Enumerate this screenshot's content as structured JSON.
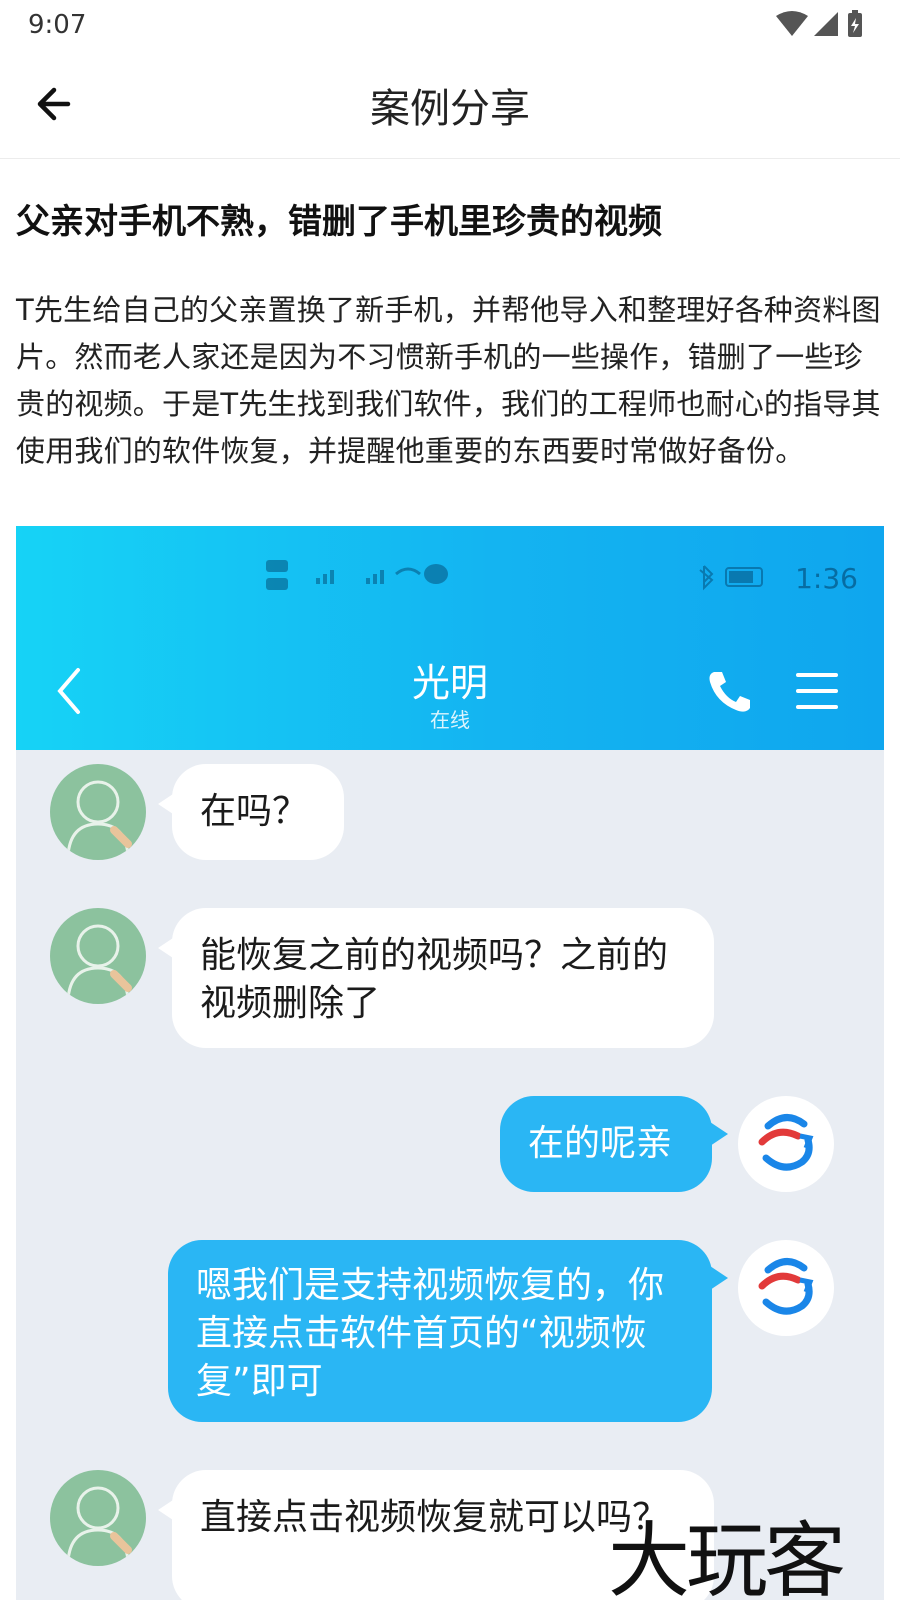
{
  "status_bar": {
    "time": "9:07"
  },
  "app_bar": {
    "title": "案例分享"
  },
  "article": {
    "title": "父亲对手机不熟，错删了手机里珍贵的视频",
    "body": "T先生给自己的父亲置换了新手机，并帮他导入和整理好各种资料图片。然而老人家还是因为不习惯新手机的一些操作，错删了一些珍贵的视频。于是T先生找到我们软件，我们的工程师也耐心的指导其使用我们的软件恢复，并提醒他重要的东西要时常做好备份。"
  },
  "screenshot": {
    "status_time": "1:36",
    "contact_name": "光明",
    "contact_status": "在线",
    "messages": [
      {
        "side": "in",
        "text": "在吗？"
      },
      {
        "side": "in",
        "text": "能恢复之前的视频吗？之前的视频删除了"
      },
      {
        "side": "out",
        "text": "在的呢亲"
      },
      {
        "side": "out",
        "text": "嗯我们是支持视频恢复的，你直接点击软件首页的“视频恢复”即可"
      },
      {
        "side": "in",
        "text": "直接点击视频恢复就可以吗？"
      }
    ],
    "colors": {
      "header": "#14b4f1",
      "chat_bg": "#e9edf3",
      "out_bubble": "#2ab6f4"
    }
  },
  "watermark": "大玩客",
  "icons": [
    "wifi-icon",
    "signal-icon",
    "battery-icon",
    "back-arrow-icon",
    "phone-icon",
    "menu-icon",
    "avatar-icon",
    "app-logo-icon"
  ]
}
